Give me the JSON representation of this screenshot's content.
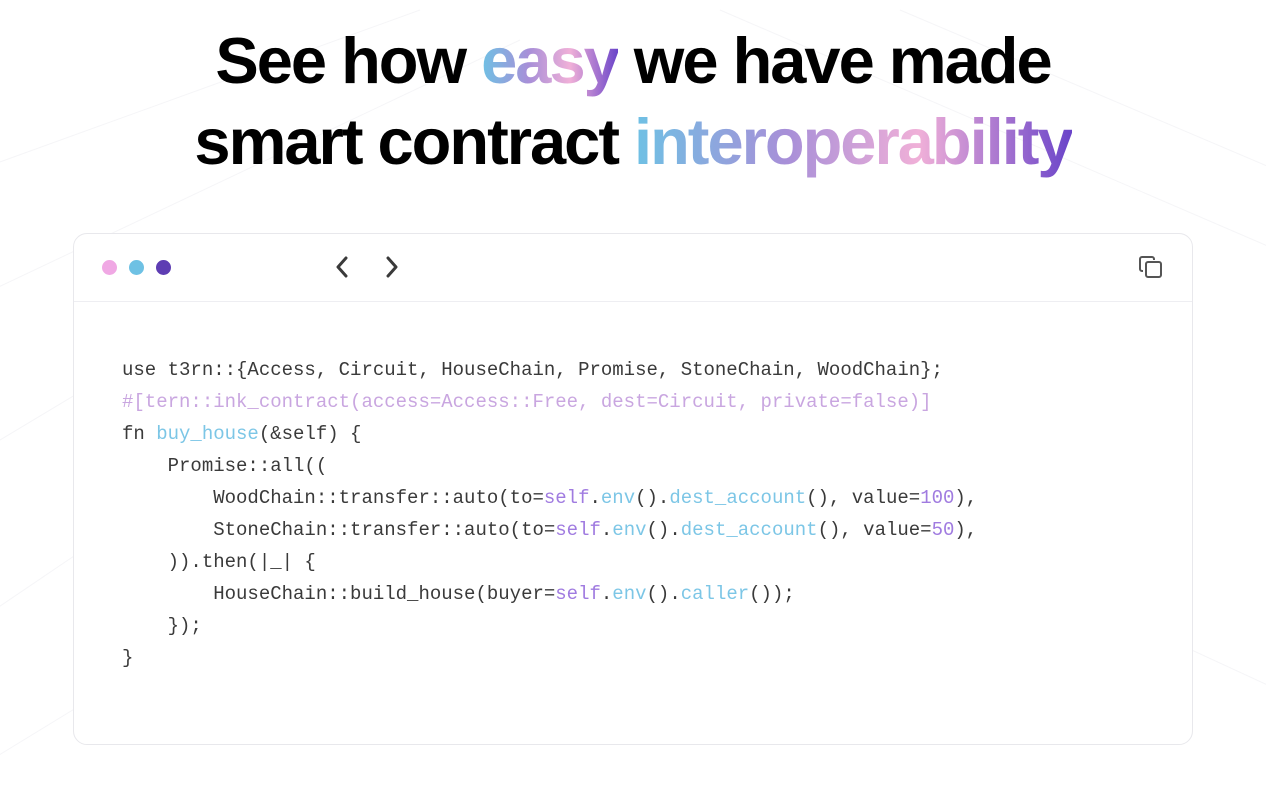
{
  "headline": {
    "p1": "See how ",
    "g1": "easy",
    "p2": " we have made",
    "p3": "smart contract ",
    "g2": "interoperability"
  },
  "dots": {
    "pink": "#f0a8e4",
    "cyan": "#6ec1e4",
    "purple": "#5e3db3"
  },
  "code": {
    "l1": "use t3rn::{Access, Circuit, HouseChain, Promise, StoneChain, WoodChain};",
    "l2": "#[tern::ink_contract(access=Access::Free, dest=Circuit, private=false)]",
    "l3a": "fn ",
    "l3fn": "buy_house",
    "l3b": "(&self) {",
    "l4": "    Promise::all((",
    "l5a": "        WoodChain::transfer::auto(to=",
    "self": "self",
    "dot": ".",
    "env": "env",
    "l5b": "().",
    "dest": "dest_account",
    "l5c": "(), value=",
    "v100": "100",
    "l5d": "),",
    "l6a": "        StoneChain::transfer::auto(to=",
    "v50": "50",
    "l6d": "),",
    "l7": "    )).then(|_| {",
    "l8a": "        HouseChain::build_house(buyer=",
    "caller": "caller",
    "l8b": "());",
    "l9": "    });",
    "l10": "}"
  }
}
